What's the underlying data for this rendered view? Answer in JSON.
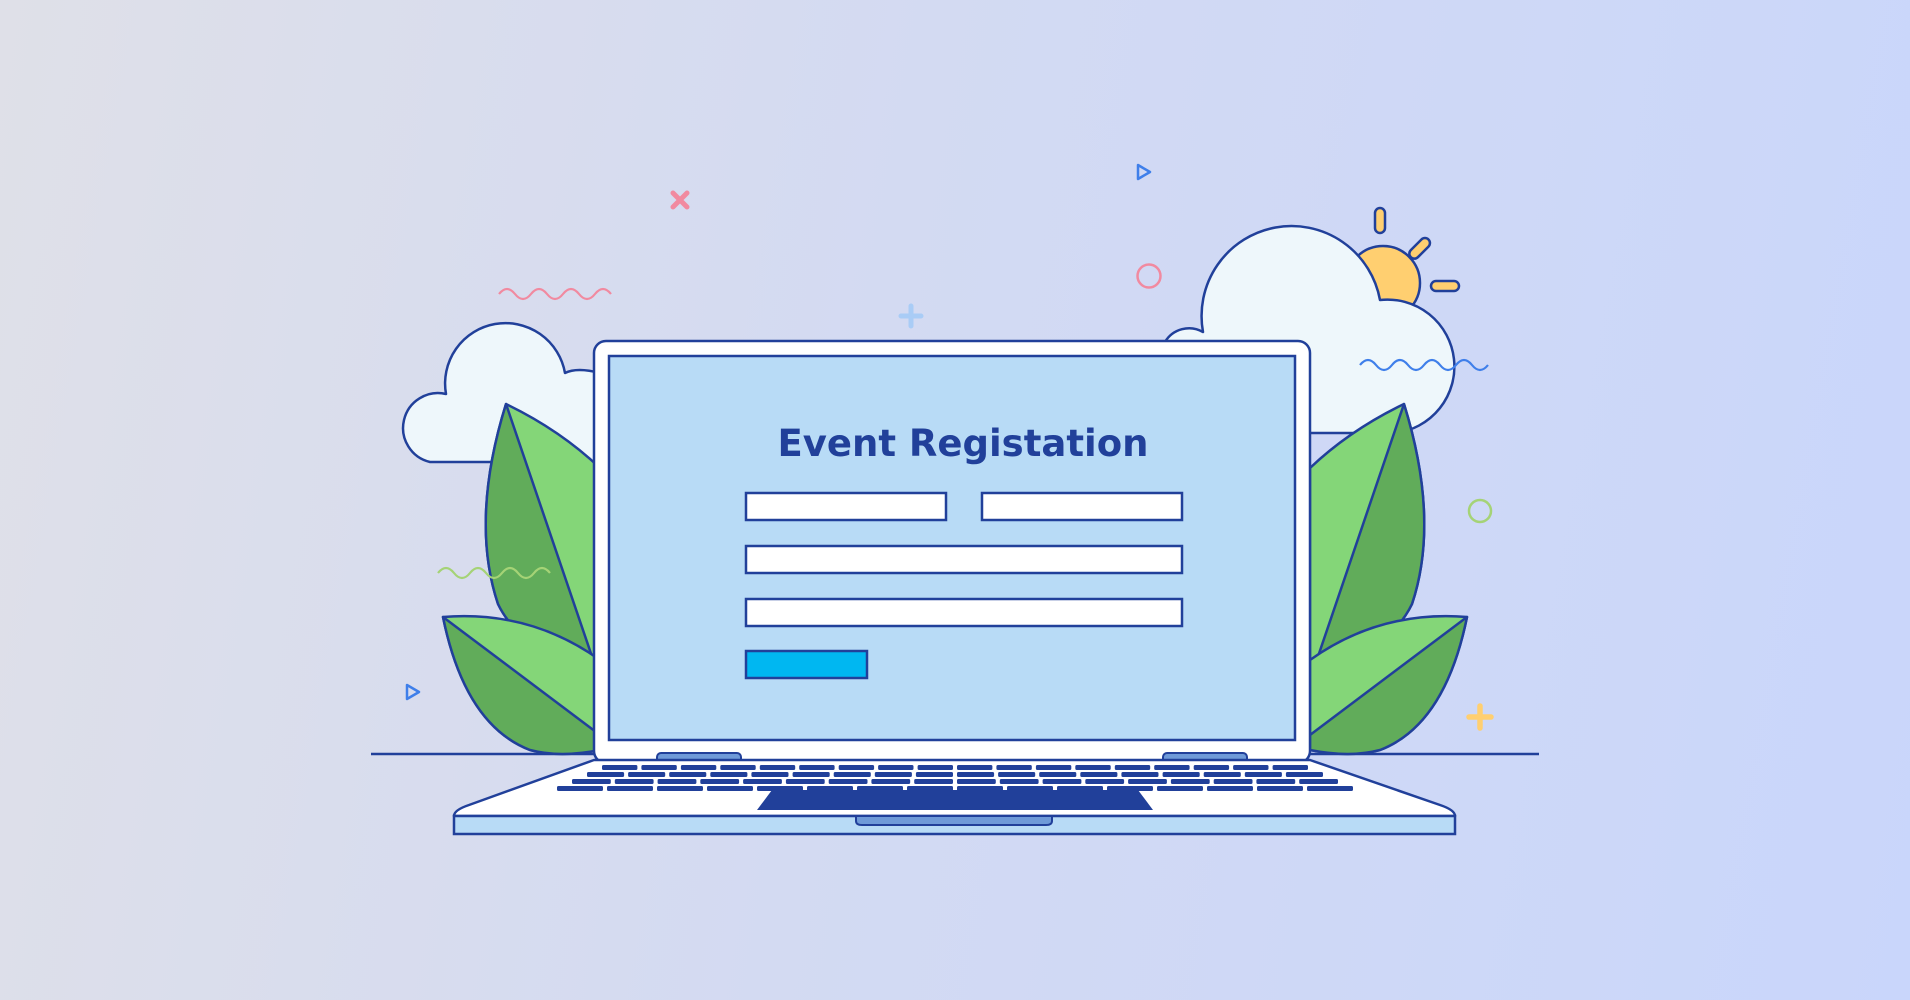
{
  "form": {
    "title": "Event Registation",
    "fields": [
      {
        "name": "first-name",
        "value": ""
      },
      {
        "name": "last-name",
        "value": ""
      },
      {
        "name": "email",
        "value": ""
      },
      {
        "name": "phone",
        "value": ""
      }
    ],
    "submit_label": ""
  },
  "icons": [
    "cloud-icon",
    "sun-icon",
    "leaf-icon",
    "laptop-icon",
    "keyboard-icon"
  ],
  "colors": {
    "outline": "#21409a",
    "screen": "#b8dbf6",
    "button": "#00b7f1",
    "leaf_light": "#84d678",
    "leaf_dark": "#61ac5a",
    "cloud": "#eef7fb",
    "sun": "#ffcf70",
    "accent_pink": "#f18aa0",
    "accent_blue": "#3f7fea",
    "accent_green": "#a5d376"
  }
}
